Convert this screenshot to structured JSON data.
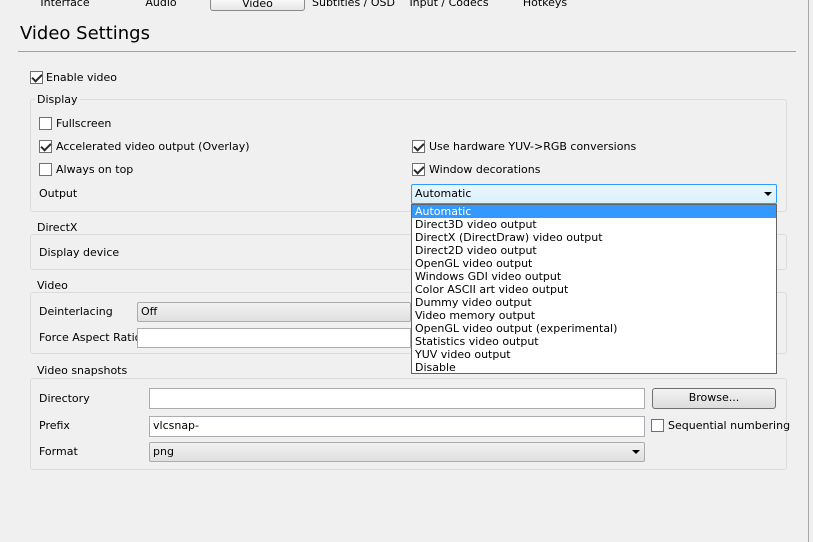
{
  "tabs": [
    {
      "label": "Interface",
      "active": false
    },
    {
      "label": "Audio",
      "active": false
    },
    {
      "label": "Video",
      "active": true
    },
    {
      "label": "Subtitles / OSD",
      "active": false
    },
    {
      "label": "Input / Codecs",
      "active": false
    },
    {
      "label": "Hotkeys",
      "active": false
    }
  ],
  "page_title": "Video Settings",
  "enable_video": {
    "label": "Enable video",
    "checked": true
  },
  "display": {
    "group_label": "Display",
    "fullscreen": {
      "label": "Fullscreen",
      "checked": false
    },
    "accelerated": {
      "label": "Accelerated video output (Overlay)",
      "checked": true
    },
    "always_on_top": {
      "label": "Always on top",
      "checked": false
    },
    "hw_yuv": {
      "label": "Use hardware YUV->RGB conversions",
      "checked": true
    },
    "window_decorations": {
      "label": "Window decorations",
      "checked": true
    },
    "output_label": "Output",
    "output_value": "Automatic",
    "output_options": [
      "Automatic",
      "Direct3D video output",
      "DirectX (DirectDraw) video output",
      "Direct2D video output",
      "OpenGL video output",
      "Windows GDI video output",
      "Color ASCII art video output",
      "Dummy video output",
      "Video memory output",
      "OpenGL video output (experimental)",
      "Statistics video output",
      "YUV video output",
      "Disable"
    ]
  },
  "directx": {
    "group_label": "DirectX",
    "display_device_label": "Display device"
  },
  "video": {
    "group_label": "Video",
    "deinterlacing_label": "Deinterlacing",
    "deinterlacing_value": "Off",
    "aspect_label": "Force Aspect Ratio",
    "aspect_value": ""
  },
  "snapshots": {
    "group_label": "Video snapshots",
    "directory_label": "Directory",
    "directory_value": "",
    "browse_label": "Browse...",
    "prefix_label": "Prefix",
    "prefix_value": "vlcsnap-",
    "sequential_label": "Sequential numbering",
    "sequential_checked": false,
    "format_label": "Format",
    "format_value": "png"
  }
}
